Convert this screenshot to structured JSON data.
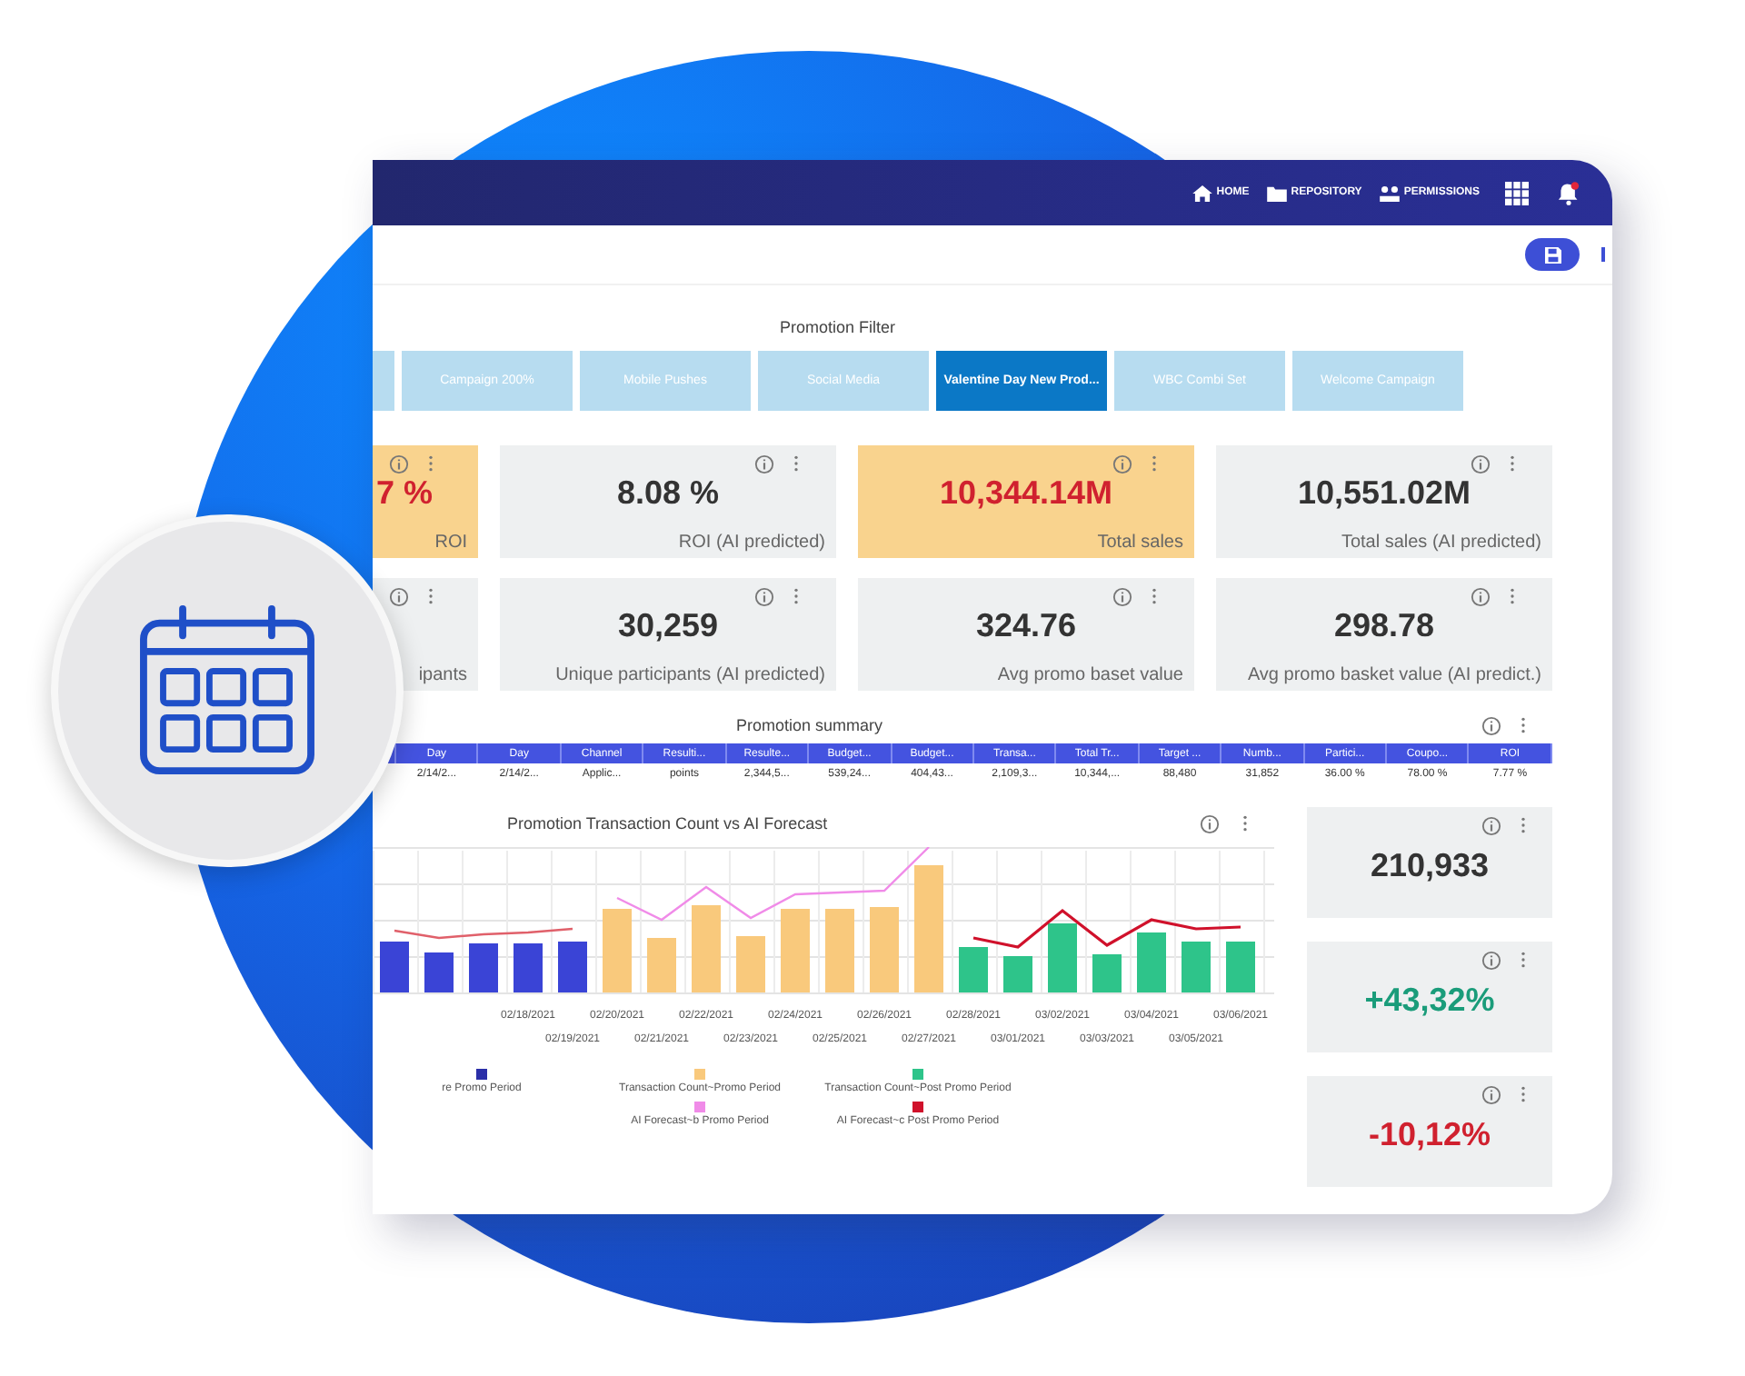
{
  "nav": [
    {
      "kind": "home",
      "label": "HOME"
    },
    {
      "kind": "folder",
      "label": "REPOSITORY"
    },
    {
      "kind": "people",
      "label": "PERMISSIONS"
    }
  ],
  "filter": {
    "title": "Promotion Filter",
    "tabs": [
      {
        "label": "Campaign 200%",
        "selected": false
      },
      {
        "label": "Mobile Pushes",
        "selected": false
      },
      {
        "label": "Social Media",
        "selected": false
      },
      {
        "label": "Valentine Day New Prod...",
        "selected": true
      },
      {
        "label": "WBC Combi Set",
        "selected": false
      },
      {
        "label": "Welcome Campaign",
        "selected": false
      }
    ]
  },
  "kpis": [
    {
      "value": "7 %",
      "label": "ROI",
      "highlighted": true,
      "kind": "alert"
    },
    {
      "value": "8.08 %",
      "label": "ROI (AI predicted)",
      "highlighted": false,
      "kind": "plain"
    },
    {
      "value": "10,344.14M",
      "label": "Total sales",
      "highlighted": true,
      "kind": "alert"
    },
    {
      "value": "10,551.02M",
      "label": "Total sales (AI predicted)",
      "highlighted": false,
      "kind": "plain"
    },
    {
      "label": "ipants",
      "highlighted": false
    },
    {
      "value": "30,259",
      "label": "Unique participants (AI predicted)",
      "highlighted": false,
      "kind": "plain"
    },
    {
      "value": "324.76",
      "label": "Avg promo baset value",
      "highlighted": false,
      "kind": "plain"
    },
    {
      "value": "298.78",
      "label": "Avg promo basket value (AI predict.)",
      "highlighted": false,
      "kind": "plain"
    }
  ],
  "summary": {
    "title": "Promotion summary",
    "columns": [
      "Day",
      "Day",
      "Channel",
      "Resulti...",
      "Resulte...",
      "Budget...",
      "Budget...",
      "Transa...",
      "Total Tr...",
      "Target ...",
      "Numb...",
      "Partici...",
      "Coupo...",
      "ROI"
    ],
    "rows": [
      [
        "2/14/2...",
        "2/14/2...",
        "Applic...",
        "points",
        "2,344,5...",
        "539,24...",
        "404,43...",
        "2,109,3...",
        "10,344,...",
        "88,480",
        "31,852",
        "36.00 %",
        "78.00 %",
        "7.77 %"
      ]
    ]
  },
  "chart": {
    "title": "Promotion Transaction Count vs AI Forecast",
    "x_labels_top": [
      "02/18/2021",
      "02/20/2021",
      "02/22/2021",
      "02/24/2021",
      "02/26/2021",
      "02/28/2021",
      "03/02/2021",
      "03/04/2021",
      "03/06/2021"
    ],
    "x_labels_bottom": [
      "02/19/2021",
      "02/21/2021",
      "02/23/2021",
      "02/25/2021",
      "02/27/2021",
      "03/01/2021",
      "03/03/2021",
      "03/05/2021"
    ],
    "legend_rows": [
      [
        {
          "label": "re Promo Period",
          "color": "#2b2fa8"
        },
        {
          "label": "Transaction Count~Promo Period",
          "color": "#f9c97c"
        },
        {
          "label": "Transaction Count~Post Promo Period",
          "color": "#2ec48a"
        }
      ],
      [
        {
          "label": "AI Forecast~b Promo Period",
          "color": "#f08be8"
        },
        {
          "label": "AI Forecast~c Post Promo Period",
          "color": "#d0112b"
        }
      ]
    ]
  },
  "side_kpis": [
    {
      "value": "210,933",
      "kind": "plain"
    },
    {
      "value": "+43,32%",
      "kind": "positive"
    },
    {
      "value": "-10,12%",
      "kind": "alert"
    }
  ]
}
